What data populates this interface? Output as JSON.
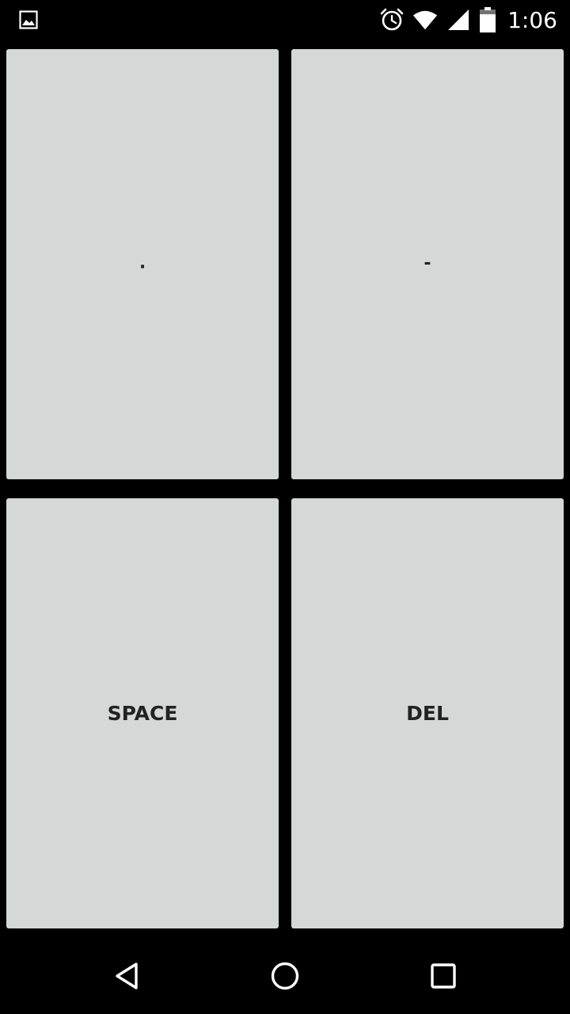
{
  "status_bar": {
    "time": "1:06",
    "icons": [
      "gallery-icon",
      "alarm-icon",
      "wifi-icon",
      "cell-signal-icon",
      "battery-icon"
    ]
  },
  "pads": {
    "dot": "·",
    "dash": "-",
    "space": "SPACE",
    "del": "DEL"
  },
  "nav_bar": {
    "icons": [
      "back-icon",
      "home-icon",
      "recents-icon"
    ]
  },
  "colors": {
    "background": "#000000",
    "pad": "#d6d7d7",
    "pad_text": "#222222",
    "status_icons": "#ffffff"
  }
}
